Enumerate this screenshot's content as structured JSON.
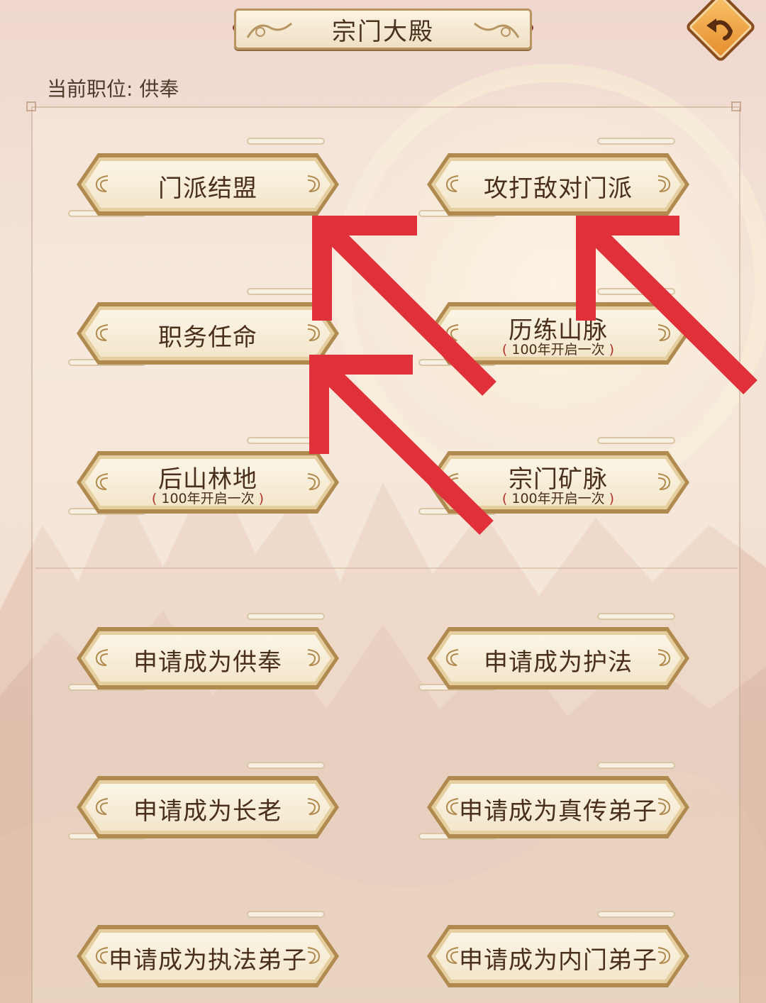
{
  "title": "宗门大殿",
  "current_position": {
    "label": "当前职位:",
    "value": "供奉"
  },
  "buttons": {
    "alliance": {
      "label": "门派结盟"
    },
    "attack": {
      "label": "攻打敌对门派"
    },
    "appoint": {
      "label": "职务任命"
    },
    "trial": {
      "label": "历练山脉",
      "sub_open": "(",
      "sub_amount": "100年开启一次",
      "sub_close": ")"
    },
    "forest": {
      "label": "后山林地",
      "sub_open": "(",
      "sub_amount": "100年开启一次",
      "sub_close": ")"
    },
    "mine": {
      "label": "宗门矿脉",
      "sub_open": "(",
      "sub_amount": "100年开启一次",
      "sub_close": ")"
    },
    "apply_gongfeng": {
      "label": "申请成为供奉"
    },
    "apply_hufa": {
      "label": "申请成为护法"
    },
    "apply_zhanglao": {
      "label": "申请成为长老"
    },
    "apply_zhenchuan": {
      "label": "申请成为真传弟子"
    },
    "apply_zhifa": {
      "label": "申请成为执法弟子"
    },
    "apply_neimen": {
      "label": "申请成为内门弟子"
    }
  },
  "colors": {
    "arrow_red": "#e0303a",
    "button_border": "#b08a4f",
    "back_button": "#e58b2a"
  },
  "icons": {
    "back": "back-arrow-icon"
  }
}
